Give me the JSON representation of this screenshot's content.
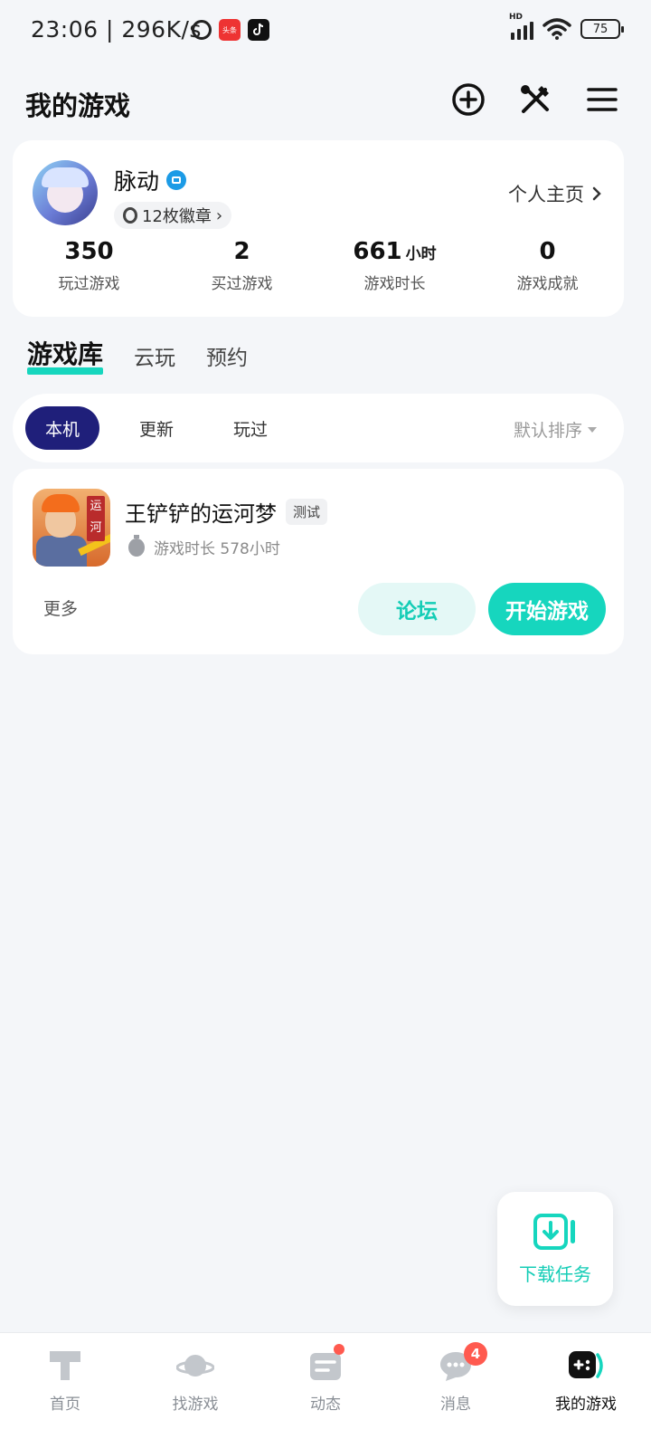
{
  "status_bar": {
    "time": "23:06 | 296K/s",
    "news_icon_text": "头条",
    "battery": "75",
    "network": "HD"
  },
  "header": {
    "title": "我的游戏"
  },
  "profile": {
    "username": "脉动",
    "badges": "12枚徽章",
    "homepage_link": "个人主页",
    "stats": [
      {
        "value": "350",
        "unit": "",
        "label": "玩过游戏"
      },
      {
        "value": "2",
        "unit": "",
        "label": "买过游戏"
      },
      {
        "value": "661",
        "unit": "小时",
        "label": "游戏时长"
      },
      {
        "value": "0",
        "unit": "",
        "label": "游戏成就"
      }
    ]
  },
  "tabs": [
    {
      "label": "游戏库",
      "active": true
    },
    {
      "label": "云玩",
      "active": false
    },
    {
      "label": "预约",
      "active": false
    }
  ],
  "filters": {
    "chips": [
      {
        "label": "本机",
        "active": true
      },
      {
        "label": "更新",
        "active": false
      },
      {
        "label": "玩过",
        "active": false
      }
    ],
    "sort_label": "默认排序"
  },
  "game": {
    "title": "王铲铲的运河梦",
    "tag": "测试",
    "icon_text": "运河",
    "playtime": "游戏时长 578小时",
    "more_label": "更多",
    "forum_label": "论坛",
    "start_label": "开始游戏"
  },
  "fab": {
    "label": "下载任务"
  },
  "bottom_nav": [
    {
      "label": "首页",
      "icon": "home-icon",
      "badge": null,
      "dot": false,
      "active": false
    },
    {
      "label": "找游戏",
      "icon": "planet-icon",
      "badge": null,
      "dot": false,
      "active": false
    },
    {
      "label": "动态",
      "icon": "feed-icon",
      "badge": null,
      "dot": true,
      "active": false
    },
    {
      "label": "消息",
      "icon": "message-icon",
      "badge": "4",
      "dot": false,
      "active": false
    },
    {
      "label": "我的游戏",
      "icon": "gamepad-icon",
      "badge": null,
      "dot": false,
      "active": true
    }
  ],
  "colors": {
    "accent": "#16d6be",
    "chip_active": "#1f1f7a",
    "badge": "#ff5a4f"
  }
}
